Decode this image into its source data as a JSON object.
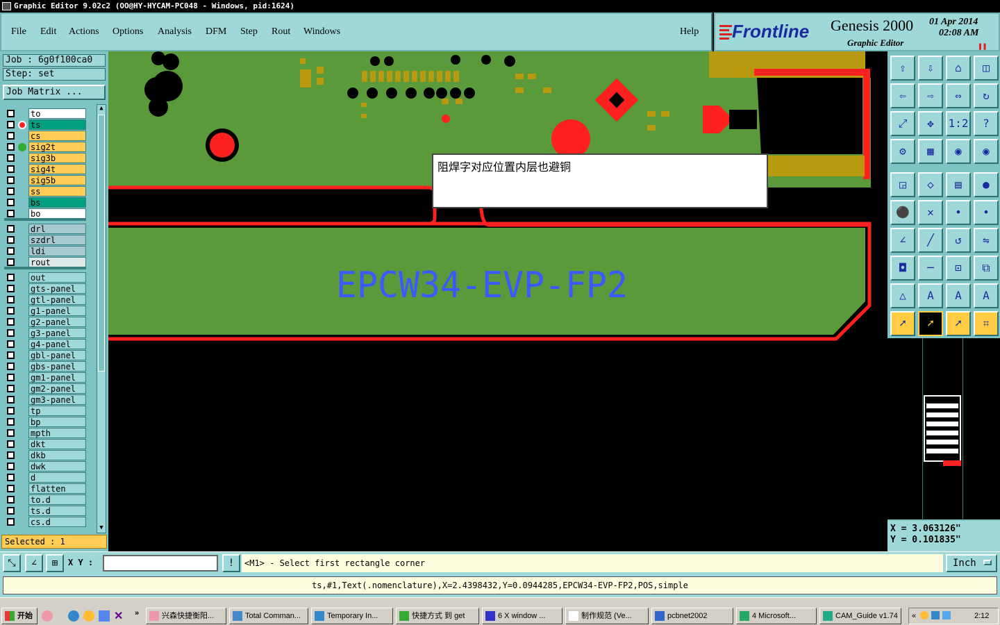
{
  "window": {
    "title": "Graphic Editor 9.02c2  (OO@HY-HYCAM-PC048 - Windows, pid:1624)"
  },
  "menu": {
    "items": [
      "File",
      "Edit",
      "Actions",
      "Options",
      "Analysis",
      "DFM",
      "Step",
      "Rout",
      "Windows"
    ],
    "help": "Help"
  },
  "brand": {
    "logo": "Frontline",
    "product": "Genesis 2000",
    "subtitle": "Graphic Editor",
    "date": "01 Apr 2014",
    "time": "02:08 AM"
  },
  "job": {
    "job_label": "Job : 6g0f100ca0",
    "step_label": "Step: set",
    "matrix_button": "Job Matrix ..."
  },
  "layers": {
    "group1": [
      {
        "name": "to",
        "color": "#ffffff"
      },
      {
        "name": "ts",
        "color": "#00a080",
        "active": true
      },
      {
        "name": "cs",
        "color": "#ffcc55"
      },
      {
        "name": "sig2t",
        "color": "#ffcc55"
      },
      {
        "name": "sig3b",
        "color": "#ffcc55"
      },
      {
        "name": "sig4t",
        "color": "#ffcc55"
      },
      {
        "name": "sig5b",
        "color": "#ffcc55"
      },
      {
        "name": "ss",
        "color": "#ffcc55"
      },
      {
        "name": "bs",
        "color": "#00a080"
      },
      {
        "name": "bo",
        "color": "#ffffff"
      }
    ],
    "group2": [
      {
        "name": "drl",
        "color": "#a8c8d0"
      },
      {
        "name": "szdrl",
        "color": "#a8c8d0"
      },
      {
        "name": "ldi",
        "color": "#a8c8d0"
      },
      {
        "name": "rout",
        "color": "#dde8e8"
      }
    ],
    "group3": [
      {
        "name": "out"
      },
      {
        "name": "gts-panel"
      },
      {
        "name": "gtl-panel"
      },
      {
        "name": "g1-panel"
      },
      {
        "name": "g2-panel"
      },
      {
        "name": "g3-panel"
      },
      {
        "name": "g4-panel"
      },
      {
        "name": "gbl-panel"
      },
      {
        "name": "gbs-panel"
      },
      {
        "name": "gm1-panel"
      },
      {
        "name": "gm2-panel"
      },
      {
        "name": "gm3-panel"
      },
      {
        "name": "tp"
      },
      {
        "name": "bp"
      },
      {
        "name": "mpth"
      },
      {
        "name": "dkt"
      },
      {
        "name": "dkb"
      },
      {
        "name": "dwk"
      },
      {
        "name": "d"
      },
      {
        "name": "flatten"
      },
      {
        "name": "to.d"
      },
      {
        "name": "ts.d"
      },
      {
        "name": "cs.d"
      }
    ],
    "selected": "Selected : 1"
  },
  "canvas": {
    "board_text": "EPCW34-EVP-FP2",
    "popup_note": "阻焊字对应位置内层也避铜"
  },
  "coords": {
    "x": "X = 3.063126\"",
    "y": "Y = 0.101835\""
  },
  "command": {
    "xy_label": "X Y :",
    "xy_value": "",
    "message": "<M1> - Select first rectangle corner",
    "unit": "Inch"
  },
  "status": {
    "feature_info": "ts,#1,Text(.nomenclature),X=2.4398432,Y=0.0944285,EPCW34-EVP-FP2,POS,simple"
  },
  "taskbar": {
    "start": "开始",
    "items": [
      "兴森快捷衡阳...",
      "Total Comman...",
      "Temporary In...",
      "快捷方式 到 get",
      "6 X window ...",
      "制作规范 (Ve...",
      "pcbnet2002",
      "4 Microsoft...",
      "CAM_Guide v1.74"
    ],
    "clock": "2:12"
  },
  "colors": {
    "panel": "#9fd8d8",
    "board_green": "#5a9a3a",
    "copper_red": "#ff2020",
    "text_blue": "#3a5aff",
    "pad_gold": "#b89a10"
  }
}
